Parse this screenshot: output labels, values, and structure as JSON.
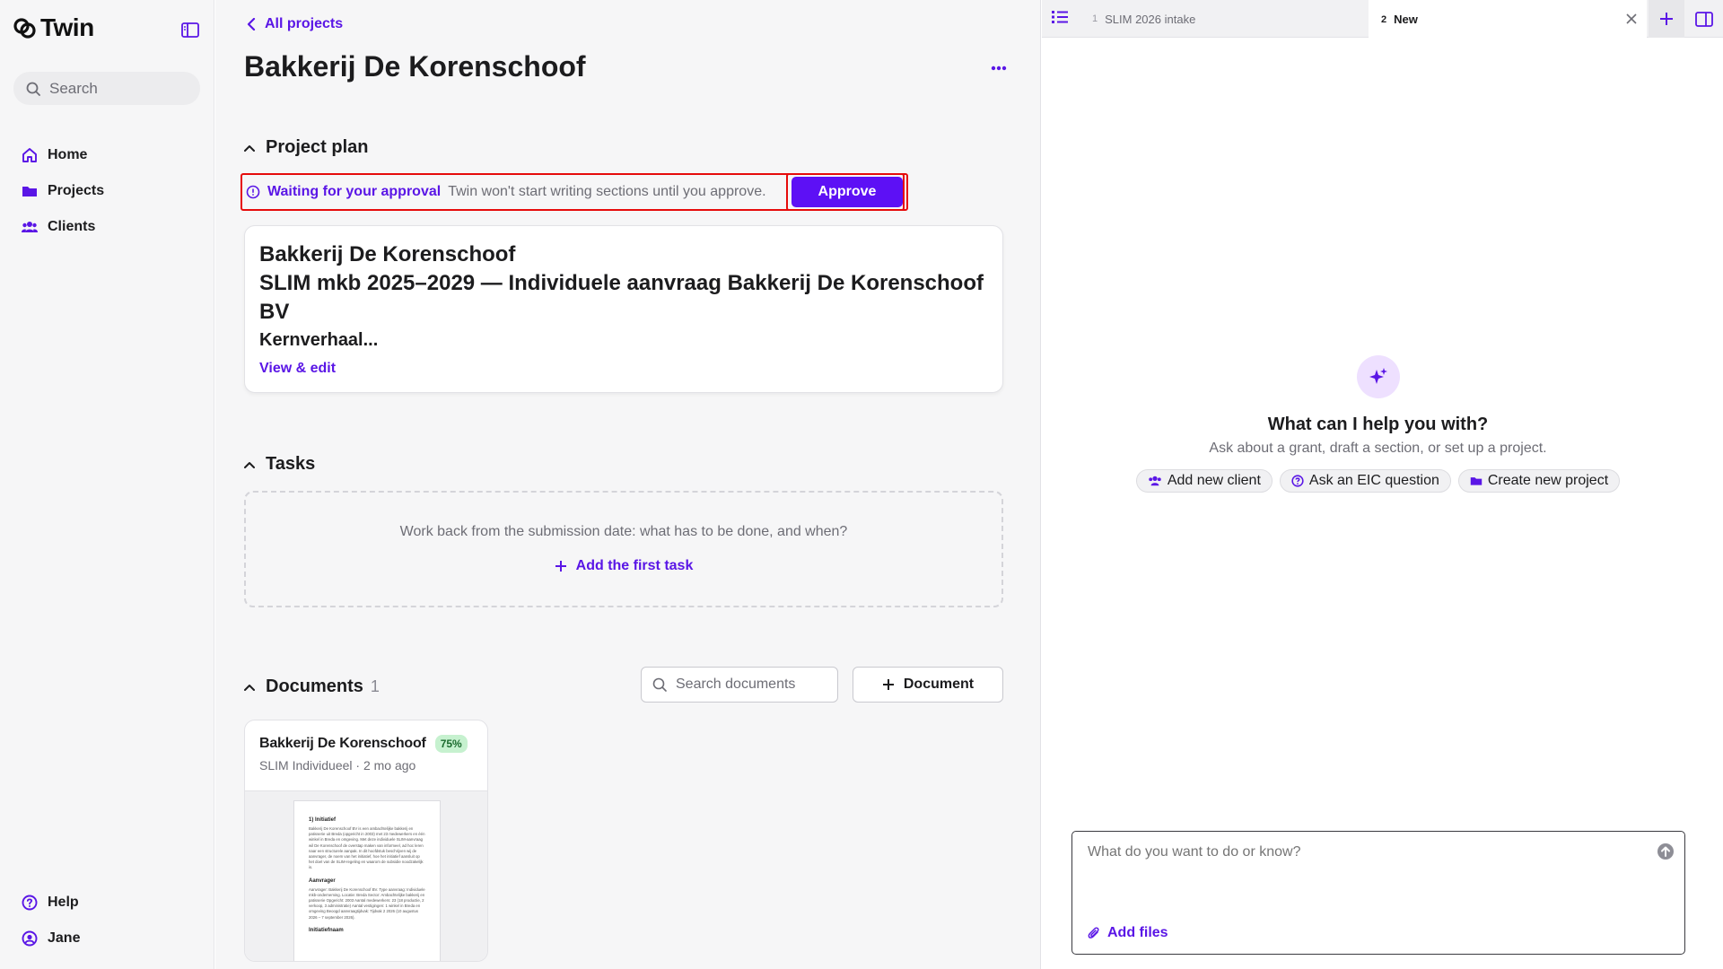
{
  "brand": {
    "name": "Twin",
    "accent": "#5d10f5",
    "highlight": "#e60b0b"
  },
  "sidebar": {
    "search_placeholder": "Search",
    "items": [
      {
        "label": "Home",
        "icon": "home-icon"
      },
      {
        "label": "Projects",
        "icon": "folder-icon"
      },
      {
        "label": "Clients",
        "icon": "users-icon"
      }
    ],
    "bottom": [
      {
        "label": "Help",
        "icon": "help-icon"
      },
      {
        "label": "Jane",
        "icon": "user-icon"
      }
    ]
  },
  "main": {
    "back_label": "All projects",
    "title": "Bakkerij De Korenschoof",
    "project_plan": {
      "heading": "Project plan",
      "approval_title": "Waiting for your approval",
      "approval_text": "Twin won't start writing sections until you approve.",
      "approve_label": "Approve",
      "card_title": "Bakkerij De Korenschoof",
      "card_subtitle": "SLIM mkb 2025–2029 — Individuele aanvraag Bakkerij De Korenschoof BV",
      "card_excerpt": "Kernverhaal...",
      "edit_label": "View & edit"
    },
    "tasks": {
      "heading": "Tasks",
      "hint": "Work back from the submission date: what has to be done, and when?",
      "add_label": "Add the first task"
    },
    "documents": {
      "heading": "Documents",
      "count": "1",
      "search_placeholder": "Search documents",
      "add_label": "Document",
      "items": [
        {
          "title": "Bakkerij De Korenschoof",
          "progress": "75%",
          "meta": "SLIM Individueel · 2 mo ago",
          "preview_heading_1": "1) Initiatief",
          "preview_body_1": "Bakkerij De Korenschoof BV is een ambachtelijke bakkerij en patisserie uit Breda (opgericht in 2003) met 23 medewerkers en één winkel in Breda en omgeving. Met deze individuele SLIM-aanvraag wil De Korenschoof de overstap maken van informeel, ad hoc leren naar een structurele aanpak. In dit hoofdstuk beschrijven wij de aanvrager, de noem van het initiatief, hoe het initiatief aansluit op het doel van de SLIM-regeling en waarom de subsidie noodzakelijk is.",
          "preview_heading_2": "Aanvrager",
          "preview_body_2": "Aanvrager: Bakkerij De Korenschoof BV. Type aanvraag: Individuele mkb-onderneming. Locatie: Breda Sector: Ambachtelijke bakkerij en patisserie Opgericht: 2003 Aantal medewerkers: 23 (18 productie, 2 verkoop, 3 administratie) Aantal vestigingen: 1 winkel in Breda en omgeving Beoogd aanvraagtijdvak: Tijdvak 2 2026 (10 augustus 2026 – 7 september 2026).",
          "preview_heading_3": "Initiatiefnaam"
        }
      ]
    }
  },
  "right": {
    "tabs": [
      {
        "num": "1",
        "label": "SLIM 2026 intake"
      },
      {
        "num": "2",
        "label": "New"
      }
    ],
    "assistant": {
      "question": "What can I help you with?",
      "subtitle": "Ask about a grant, draft a section, or set up a project.",
      "chips": [
        {
          "label": "Add new client",
          "icon": "users-icon"
        },
        {
          "label": "Ask an EIC question",
          "icon": "help-icon"
        },
        {
          "label": "Create new project",
          "icon": "folder-icon"
        }
      ]
    },
    "composer": {
      "placeholder": "What do you want to do or know?",
      "add_files_label": "Add files"
    }
  }
}
